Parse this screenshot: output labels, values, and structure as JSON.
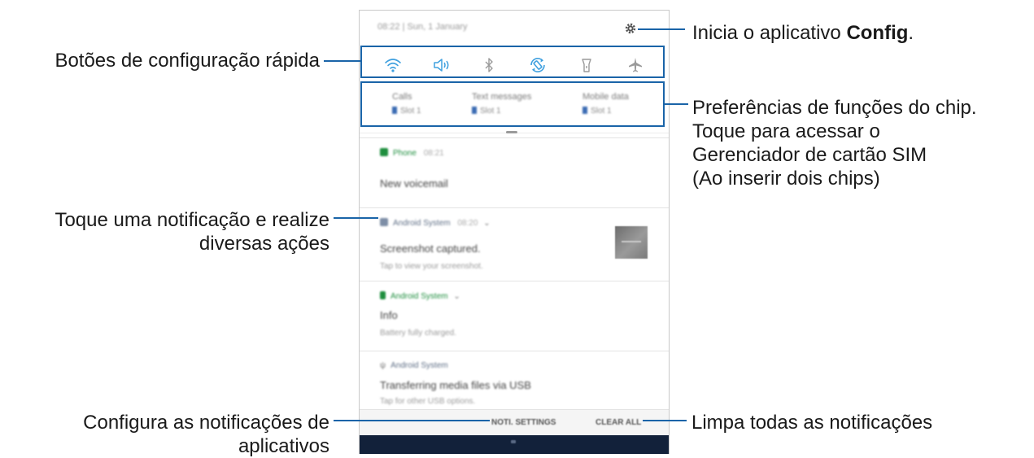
{
  "phone": {
    "status_text": "08:22  |  Sun, 1 January",
    "quick_icons": [
      "wifi-icon",
      "sound-icon",
      "bluetooth-icon",
      "auto-rotate-icon",
      "flashlight-icon",
      "airplane-icon"
    ],
    "sim_prefs": [
      {
        "title": "Calls",
        "value": "Slot 1"
      },
      {
        "title": "Text messages",
        "value": "Slot 1"
      },
      {
        "title": "Mobile data",
        "value": "Slot 1"
      }
    ],
    "notifications": [
      {
        "app": "Phone",
        "time": "08:21",
        "title": "New voicemail",
        "subtitle": "",
        "app_color": "#1e8e3e"
      },
      {
        "app": "Android System",
        "time": "08:20",
        "title": "Screenshot captured.",
        "subtitle": "Tap to view your screenshot.",
        "app_color": "#5f6f86"
      },
      {
        "app": "Android System",
        "time": "",
        "title": "Info",
        "subtitle": "Battery fully charged.",
        "app_color": "#1e8e3e"
      },
      {
        "app": "Android System",
        "time": "",
        "title": "Transferring media files via USB",
        "subtitle": "Tap for other USB options.",
        "app_color": "#5f6f86"
      }
    ],
    "footer": {
      "settings": "NOTI. SETTINGS",
      "clear": "CLEAR ALL"
    }
  },
  "callouts": {
    "config_prefix": "Inicia o aplicativo ",
    "config_bold": "Config",
    "config_suffix": ".",
    "quick_settings": "Botões de configuração rápida",
    "sim_line1": "Preferências de funções do chip.",
    "sim_line2": "Toque para acessar o",
    "sim_line3": "Gerenciador de cartão SIM",
    "sim_line4": "(Ao inserir dois chips)",
    "notif_line1": "Toque uma notificação e realize",
    "notif_line2": "diversas ações",
    "noti_settings_line1": "Configura as notificações de",
    "noti_settings_line2": "aplicativos",
    "clear_all": "Limpa todas as notificações"
  },
  "colors": {
    "accent": "#1a64a8",
    "navbar": "#12213a"
  }
}
